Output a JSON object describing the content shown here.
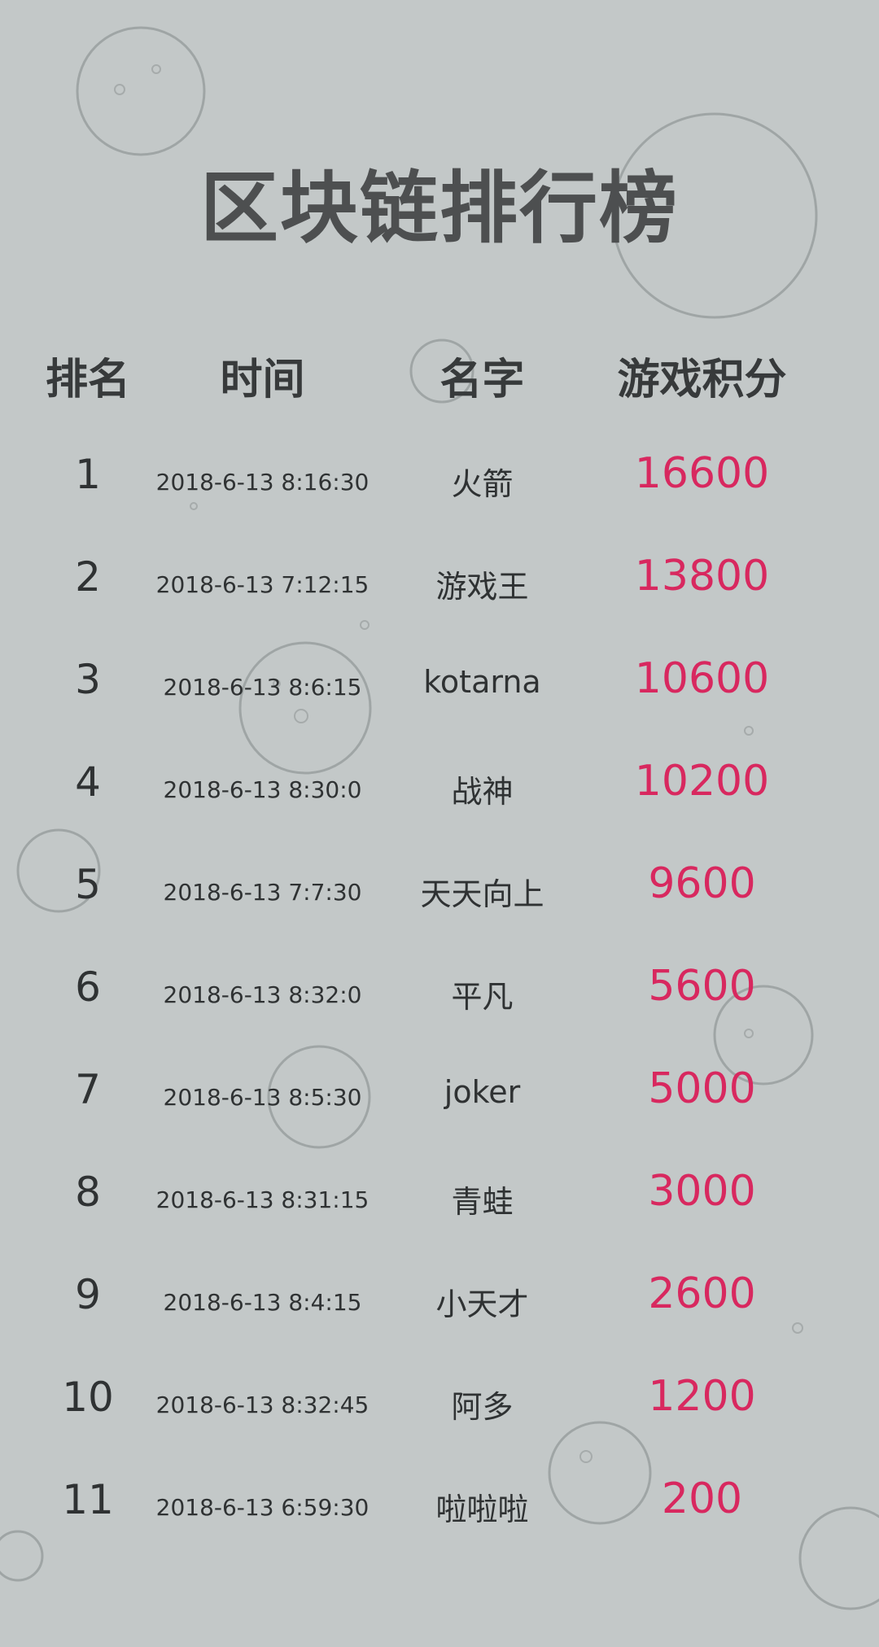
{
  "title": "区块链排行榜",
  "headers": {
    "rank": "排名",
    "time": "时间",
    "name": "名字",
    "score": "游戏积分"
  },
  "rows": [
    {
      "rank": "1",
      "time": "2018-6-13 8:16:30",
      "name": "火箭",
      "score": "16600"
    },
    {
      "rank": "2",
      "time": "2018-6-13 7:12:15",
      "name": "游戏王",
      "score": "13800"
    },
    {
      "rank": "3",
      "time": "2018-6-13 8:6:15",
      "name": "kotarna",
      "score": "10600"
    },
    {
      "rank": "4",
      "time": "2018-6-13 8:30:0",
      "name": "战神",
      "score": "10200"
    },
    {
      "rank": "5",
      "time": "2018-6-13 7:7:30",
      "name": "天天向上",
      "score": "9600"
    },
    {
      "rank": "6",
      "time": "2018-6-13 8:32:0",
      "name": "平凡",
      "score": "5600"
    },
    {
      "rank": "7",
      "time": "2018-6-13 8:5:30",
      "name": "joker",
      "score": "5000"
    },
    {
      "rank": "8",
      "time": "2018-6-13 8:31:15",
      "name": "青蛙",
      "score": "3000"
    },
    {
      "rank": "9",
      "time": "2018-6-13 8:4:15",
      "name": "小天才",
      "score": "2600"
    },
    {
      "rank": "10",
      "time": "2018-6-13 8:32:45",
      "name": "阿多",
      "score": "1200"
    },
    {
      "rank": "11",
      "time": "2018-6-13 6:59:30",
      "name": "啦啦啦",
      "score": "200"
    }
  ],
  "colors": {
    "background": "#c3c8c8",
    "score": "#d8285f",
    "text": "#2f3233",
    "title": "#4d4f50"
  }
}
